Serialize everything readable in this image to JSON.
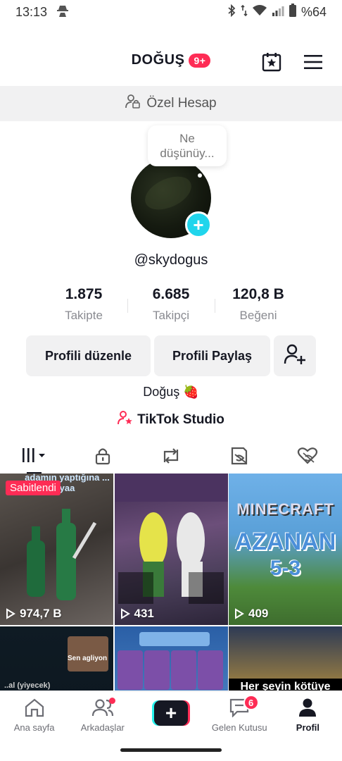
{
  "status_bar": {
    "time": "13:13",
    "battery": "%64"
  },
  "header": {
    "title": "DOĞUŞ",
    "badge": "9+"
  },
  "private_bar": {
    "label": "Özel Hesap"
  },
  "profile": {
    "thought_line1": "Ne",
    "thought_line2": "düşünüy...",
    "handle": "@skydogus",
    "stats": [
      {
        "value": "1.875",
        "label": "Takipte"
      },
      {
        "value": "6.685",
        "label": "Takipçi"
      },
      {
        "value": "120,8 B",
        "label": "Beğeni"
      }
    ],
    "edit_button": "Profili düzenle",
    "share_button": "Profili Paylaş",
    "bio": "Doğuş 🍓",
    "studio": "TikTok Studio"
  },
  "videos": [
    {
      "plays": "974,7 B",
      "pinned": "Sabitlendi",
      "caption": "adamın yaptığına ... yaa"
    },
    {
      "plays": "431"
    },
    {
      "plays": "409",
      "title": "MINECRAFT",
      "overlay_line1": "AZANAN",
      "overlay_line2": "5-3"
    },
    {
      "caption": "Sen agliyon",
      "subcaption": "..al (yiyecek)"
    },
    {},
    {
      "caption": "Her şeyin kötüye"
    }
  ],
  "bottom_nav": {
    "home": "Ana sayfa",
    "friends": "Arkadaşlar",
    "inbox": "Gelen Kutusu",
    "inbox_count": "6",
    "profile": "Profil"
  },
  "colors": {
    "accent": "#fe2c55",
    "cyan": "#20d5ec",
    "text": "#161823",
    "muted": "#8a8b91"
  },
  "icons": [
    "incognito-icon",
    "bluetooth-icon",
    "data-arrows-icon",
    "wifi-icon",
    "signal-icon",
    "battery-icon",
    "calendar-star-icon",
    "menu-icon",
    "user-lock-icon",
    "add-friend-icon",
    "studio-icon",
    "videos-grid-icon",
    "lock-icon",
    "repost-icon",
    "favorites-icon",
    "liked-icon",
    "play-icon",
    "home-icon",
    "friends-icon",
    "inbox-icon",
    "profile-icon"
  ]
}
